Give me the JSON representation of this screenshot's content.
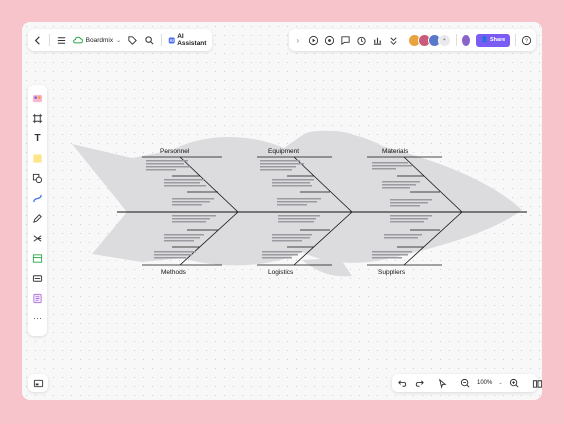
{
  "app": {
    "name": "Boardmix",
    "ai_label": "AI Assistant",
    "share_label": "Share",
    "zoom": "100%",
    "accent": "#7a5cf5",
    "background": "#f7c4cb"
  },
  "toolbar_left_icons": [
    "back-icon",
    "menu-icon",
    "cloud-icon",
    "tag-icon",
    "search-icon"
  ],
  "toolbar_right_icons": [
    "play-icon",
    "present-icon",
    "comment-icon",
    "timer-icon",
    "chart-icon",
    "expand-icon",
    "help-icon"
  ],
  "sidebar_tools": [
    "template-icon",
    "frame-icon",
    "text-icon",
    "sticky-note-icon",
    "shape-icon",
    "connector-icon",
    "pen-icon",
    "mindmap-icon",
    "table-icon",
    "text-box-icon",
    "more-tools-icon"
  ],
  "bottom_icons": [
    "minimap-icon",
    "undo-icon",
    "redo-icon",
    "pointer-icon",
    "zoom-out-icon",
    "zoom-in-icon",
    "book-icon"
  ],
  "diagram": {
    "top_categories": [
      "Personnel",
      "Equipment",
      "Materials"
    ],
    "bottom_categories": [
      "Methods",
      "Logistics",
      "Suppliers"
    ],
    "fish_color": "#d9d9dc"
  }
}
